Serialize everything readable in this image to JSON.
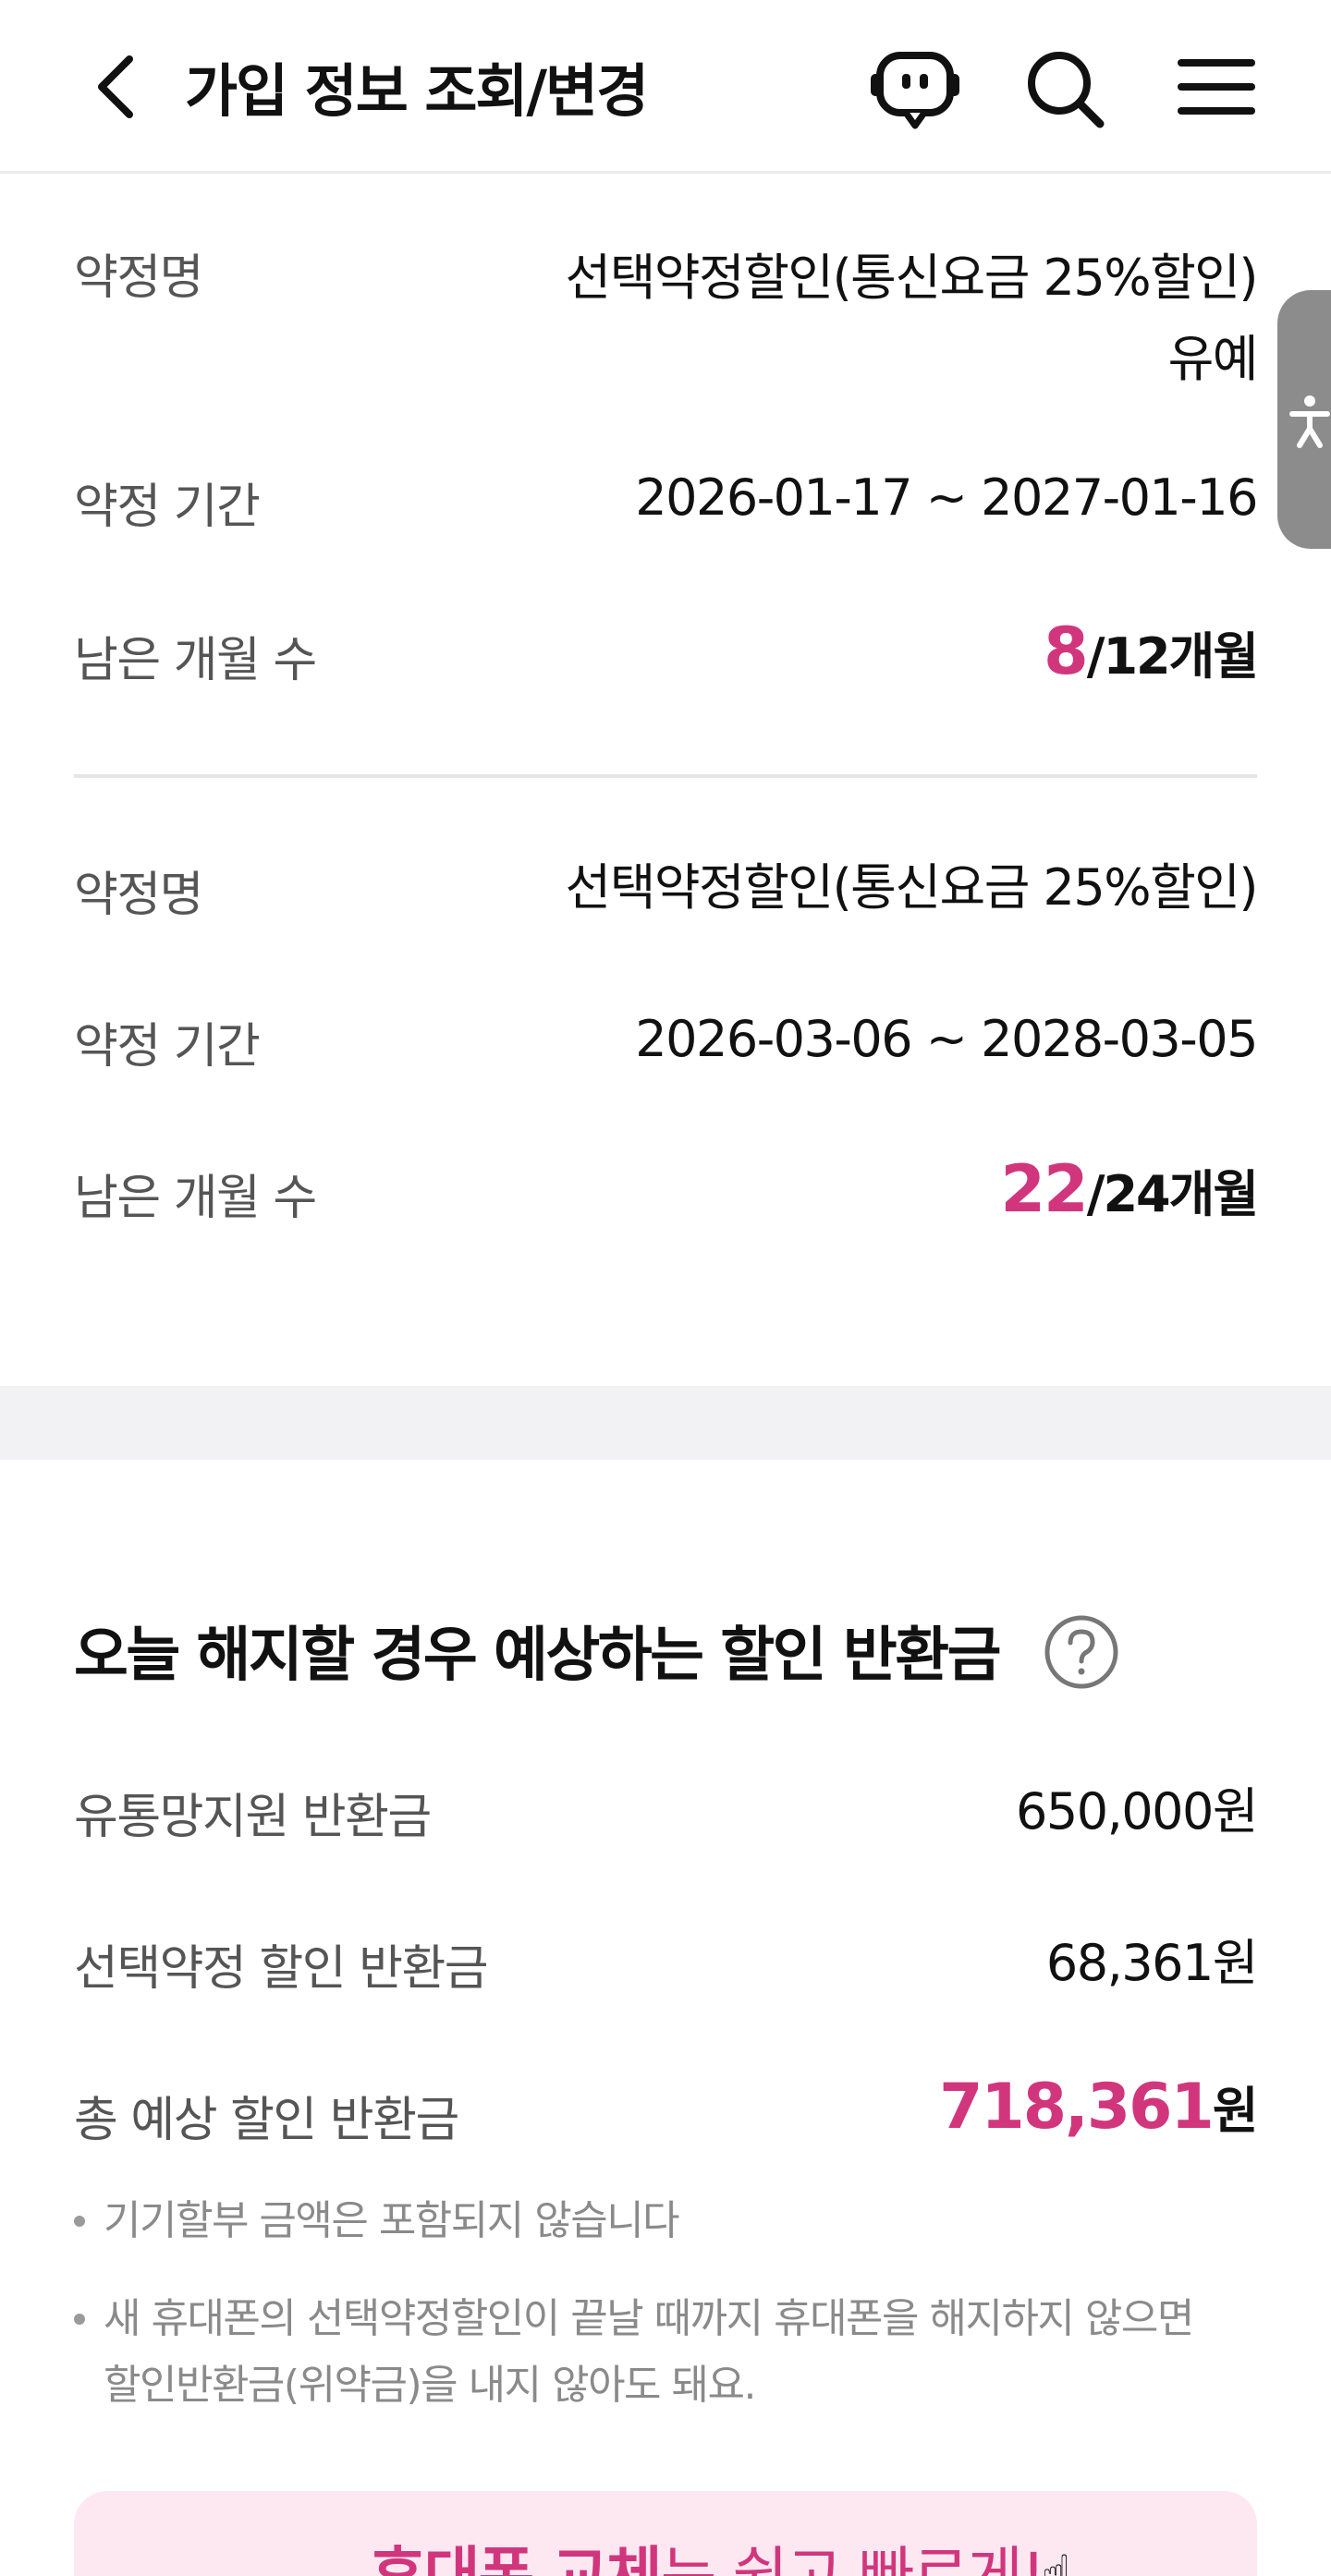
{
  "header": {
    "title": "가입 정보 조회/변경",
    "back_icon": "chevron-left-icon",
    "chatbot_icon": "chatbot-icon",
    "search_icon": "search-icon",
    "menu_icon": "hamburger-menu-icon"
  },
  "accessibility_tab": {
    "icon": "accessibility-icon"
  },
  "contracts": [
    {
      "name_label": "약정명",
      "name_value": "선택약정할인(통신요금 25%할인)",
      "name_suffix": "유예",
      "period_label": "약정 기간",
      "period_value": "2026-01-17 ~ 2027-01-16",
      "remaining_label": "남은 개월 수",
      "remaining_num": "8",
      "remaining_rest": "/12개월"
    },
    {
      "name_label": "약정명",
      "name_value": "선택약정할인(통신요금 25%할인)",
      "period_label": "약정 기간",
      "period_value": "2026-03-06 ~ 2028-03-05",
      "remaining_label": "남은 개월 수",
      "remaining_num": "22",
      "remaining_rest": "/24개월"
    }
  ],
  "refund": {
    "title": "오늘 해지할 경우 예상하는 할인 반환금",
    "help_icon": "question-circle-icon",
    "rows": [
      {
        "label": "유통망지원 반환금",
        "value": "650,000원"
      },
      {
        "label": "선택약정 할인 반환금",
        "value": "68,361원"
      }
    ],
    "total_label": "총 예상 할인 반환금",
    "total_value": "718,361",
    "total_unit": "원",
    "notes": [
      "기기할부 금액은 포함되지 않습니다",
      "새 휴대폰의 선택약정할인이 끝날 때까지 휴대폰을 해지하지 않으면",
      "할인반환금(위약금)을 내지 않아도 돼요."
    ]
  },
  "promo": {
    "bold": "휴대폰 교체",
    "rest": "는 쉽고 빠르게!",
    "icon": "pointing-hand-icon"
  },
  "colors": {
    "accent": "#d1367d",
    "label_gray": "#555555",
    "note_gray": "#8a8a8a",
    "band_gray": "#f2f2f4",
    "promo_bg": "#fde8f1"
  }
}
